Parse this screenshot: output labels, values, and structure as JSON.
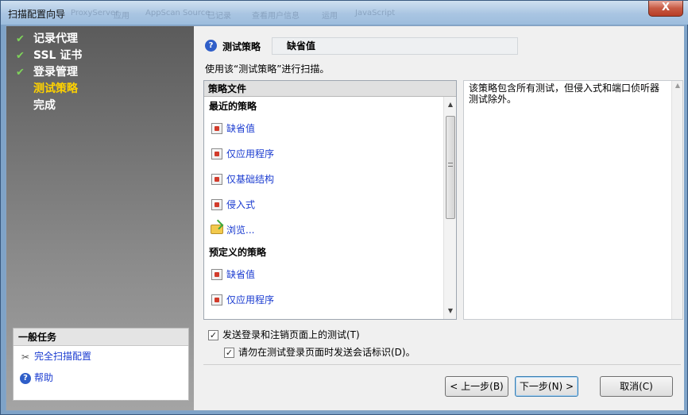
{
  "window": {
    "title": "扫描配置向导",
    "close_label": "X",
    "background_ghost_text": [
      "ProxyServer",
      "应用",
      "AppScan Source",
      "已记录",
      "查看用户信息",
      "运用",
      "JavaScript"
    ]
  },
  "wizard_steps": [
    {
      "label": "记录代理",
      "status": "done"
    },
    {
      "label": "SSL 证书",
      "status": "done"
    },
    {
      "label": "登录管理",
      "status": "done"
    },
    {
      "label": "测试策略",
      "status": "current"
    },
    {
      "label": "完成",
      "status": "pending"
    }
  ],
  "step_check_glyph": "✔",
  "general_tasks": {
    "title": "一般任务",
    "items": [
      {
        "label": "完全扫描配置",
        "icon": "tools-icon",
        "glyph": "✂"
      },
      {
        "label": "帮助",
        "icon": "help-icon",
        "glyph": "?"
      }
    ]
  },
  "policy": {
    "icon_glyph": "?",
    "label": "测试策略",
    "value": "缺省值",
    "instruction": "使用该“测试策略”进行扫描。"
  },
  "policy_files": {
    "header": "策略文件",
    "recent_title": "最近的策略",
    "recent": [
      {
        "label": "缺省值",
        "icon": "policy-file-icon"
      },
      {
        "label": "仅应用程序",
        "icon": "policy-file-icon"
      },
      {
        "label": "仅基础结构",
        "icon": "policy-file-icon"
      },
      {
        "label": "侵入式",
        "icon": "policy-file-icon"
      },
      {
        "label": "浏览...",
        "icon": "open-folder-icon"
      }
    ],
    "predefined_title": "预定义的策略",
    "predefined": [
      {
        "label": "缺省值",
        "icon": "policy-file-icon"
      },
      {
        "label": "仅应用程序",
        "icon": "policy-file-icon"
      }
    ],
    "scroll_up_glyph": "▲",
    "scroll_down_glyph": "▼"
  },
  "description": {
    "text": "该策略包含所有测试，但侵入式和端口侦听器测试除外。"
  },
  "options": {
    "send_login_logout": {
      "label": "发送登录和注销页面上的测试(T)",
      "checked": true
    },
    "no_session_ids": {
      "label": "请勿在测试登录页面时发送会话标识(D)。",
      "checked": true
    },
    "check_glyph": "✓"
  },
  "buttons": {
    "back": "< 上一步(B)",
    "next": "下一步(N) >",
    "cancel": "取消(C)"
  }
}
